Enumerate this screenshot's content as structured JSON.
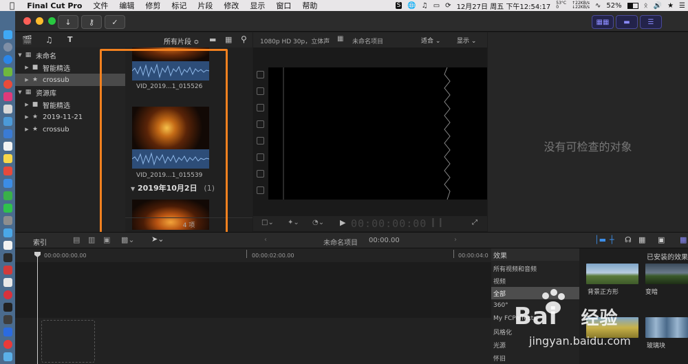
{
  "menubar": {
    "app_name": "Final Cut Pro",
    "items": [
      "文件",
      "编辑",
      "修剪",
      "标记",
      "片段",
      "修改",
      "显示",
      "窗口",
      "帮助"
    ],
    "status": {
      "temp": "53°C",
      "fan": "0",
      "net_up": "22KB/s",
      "net_down": "22KB/s",
      "battery": "52%",
      "clock": "12月27日 周五 下午12:54:17"
    }
  },
  "library": {
    "items": [
      {
        "label": "未命名",
        "level": 0,
        "icon": "library-grid-icon",
        "expanded": true
      },
      {
        "label": "智能精选",
        "level": 1,
        "icon": "folder-icon",
        "expanded": false
      },
      {
        "label": "crossub",
        "level": 1,
        "icon": "event-star-icon",
        "expanded": false,
        "selected": true
      },
      {
        "label": "资源库",
        "level": 0,
        "icon": "library-grid-icon",
        "expanded": true
      },
      {
        "label": "智能精选",
        "level": 1,
        "icon": "folder-icon",
        "expanded": false
      },
      {
        "label": "2019-11-21",
        "level": 1,
        "icon": "event-star-icon",
        "expanded": false
      },
      {
        "label": "crossub",
        "level": 1,
        "icon": "event-star-icon",
        "expanded": false
      }
    ]
  },
  "browser": {
    "filter_label": "所有片段 ≎",
    "clips": [
      {
        "label": "VID_2019...1_015526"
      },
      {
        "label": "VID_2019...1_015539"
      }
    ],
    "date_group": "2019年10月2日",
    "date_group_count": "(1)",
    "footer_count": "4 项"
  },
  "viewer": {
    "format": "1080p HD 30p，立体声",
    "project_name": "未命名项目",
    "fit_label": "适合",
    "display_label": "显示",
    "timecode": "00:00:00:00"
  },
  "inspector": {
    "empty_message": "没有可检查的对象"
  },
  "timeline": {
    "index_label": "索引",
    "project_name": "未命名项目",
    "project_timecode": "00:00.00",
    "ruler_marks": [
      "00:00:00:00.00",
      "00:00:02:00.00",
      "00:00:04:0"
    ]
  },
  "effects": {
    "header": "效果",
    "installed_header": "已安装的效果",
    "categories": [
      "所有视频和音频",
      "视频",
      "全部",
      "360°",
      "My FCPeffects",
      "风格化",
      "光源",
      "怀旧"
    ],
    "selected_category": 2,
    "thumbs": [
      "背景正方形",
      "变暗",
      "",
      "玻璃块"
    ]
  },
  "watermark": {
    "brand": "Bai",
    "brand_suffix": "经验",
    "url": "jingyan.baidu.com"
  },
  "colors": {
    "highlight_orange": "#f2811f",
    "accent_purple": "#8c8cff",
    "timeline_blue": "#3d8ee8"
  }
}
